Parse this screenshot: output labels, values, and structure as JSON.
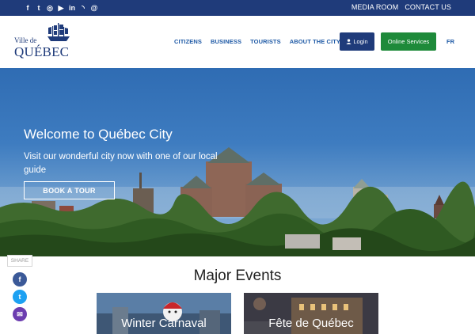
{
  "topbar": {
    "social_icons": [
      {
        "name": "facebook-icon",
        "glyph": "f"
      },
      {
        "name": "twitter-icon",
        "glyph": "t"
      },
      {
        "name": "instagram-icon",
        "glyph": "◎"
      },
      {
        "name": "youtube-icon",
        "glyph": "▶"
      },
      {
        "name": "linkedin-icon",
        "glyph": "in"
      },
      {
        "name": "rss-icon",
        "glyph": "◝"
      },
      {
        "name": "email-icon",
        "glyph": "@"
      }
    ],
    "links": {
      "media_room": "MEDIA ROOM",
      "contact_us": "CONTACT US"
    },
    "color": "#1f3b7a"
  },
  "header": {
    "logo": {
      "line1": "Ville de",
      "line2": "QUÉBEC"
    },
    "nav": {
      "citizens": "CITIZENS",
      "business": "BUSINESS",
      "tourists": "TOURISTS",
      "about": "ABOUT THE CITY"
    },
    "login": "Login",
    "online_services": "Online Services",
    "language": "FR",
    "colors": {
      "login": "#1f3b7a",
      "services": "#1e8a3a",
      "nav": "#1f5aa6"
    }
  },
  "hero": {
    "title": "Welcome to Québec City",
    "subtitle": "Visit our wonderful city now with one of our local guide",
    "button": "BOOK A TOUR"
  },
  "share": {
    "label": "SHARE",
    "buttons": [
      {
        "name": "facebook-share-icon",
        "glyph": "f",
        "color": "#3b5998"
      },
      {
        "name": "twitter-share-icon",
        "glyph": "t",
        "color": "#1da1f2"
      },
      {
        "name": "email-share-icon",
        "glyph": "✉",
        "color": "#6c3db0"
      }
    ]
  },
  "events": {
    "title": "Major Events",
    "cards": [
      "Winter Carnaval",
      "Fête de Québec"
    ]
  }
}
